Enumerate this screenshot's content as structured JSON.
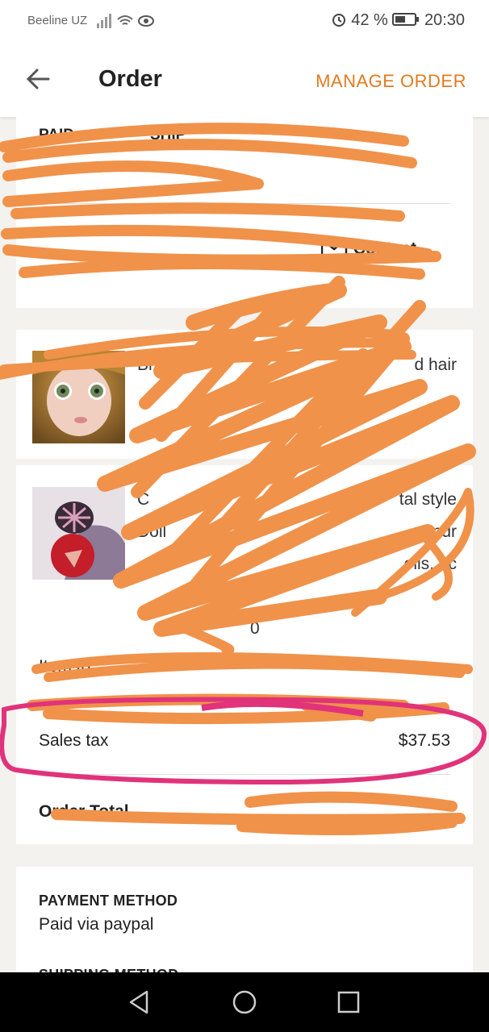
{
  "status_bar": {
    "carrier": "Beeline UZ",
    "battery": "42 %",
    "time": "20:30"
  },
  "header": {
    "title": "Order",
    "action": "MANAGE ORDER"
  },
  "summary": {
    "paid_label": "PAID",
    "ship_label": "SHIP",
    "contact_label": "Contact"
  },
  "items": [
    {
      "title_fragment": "Bl",
      "title_end": "d hair"
    },
    {
      "title_fragment": "C",
      "line2": "Doll",
      "line2_end": "ndr",
      "line3_end": "olls, ac",
      "title_end": "tal style",
      "price_fragment": "0"
    }
  ],
  "totals": {
    "item_total_label": "Item to",
    "sales_tax_label": "Sales tax",
    "sales_tax_value": "$37.53",
    "order_total_label": "Order Total"
  },
  "payment": {
    "label": "PAYMENT METHOD",
    "value": "Paid via paypal"
  },
  "shipping": {
    "label": "SHIPPING METHOD"
  },
  "colors": {
    "accent": "#e07b22",
    "scribble": "#f0924a",
    "highlight": "#e0337a"
  }
}
